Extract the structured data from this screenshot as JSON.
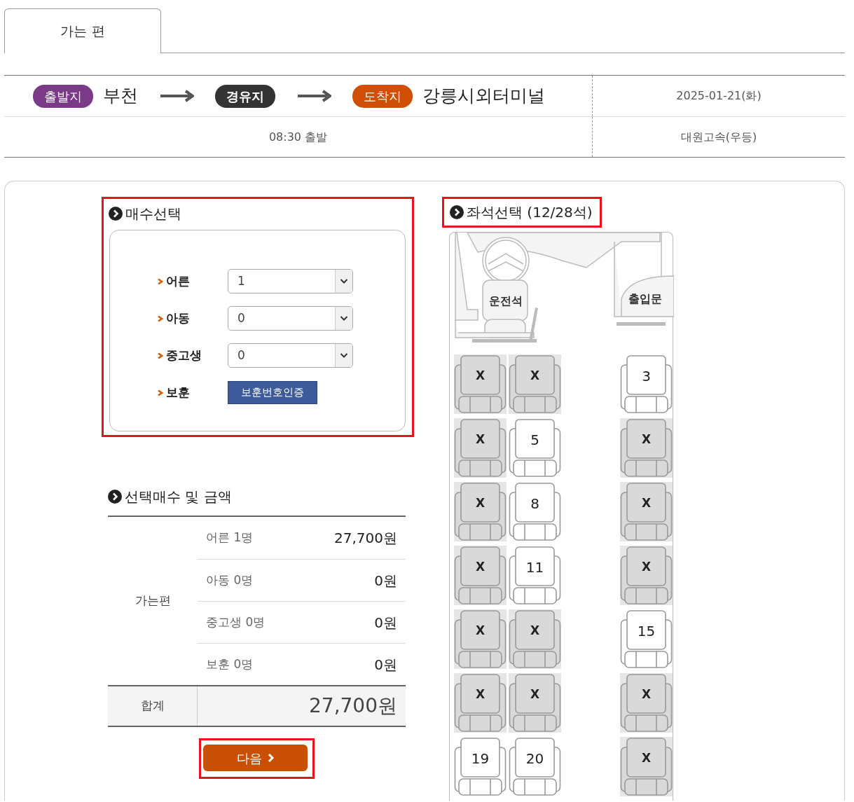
{
  "tabs": [
    {
      "label": "가는 편",
      "selected": true
    }
  ],
  "route": {
    "stops": [
      {
        "kind": "departure",
        "badge": "출발지",
        "name": "부천",
        "color": "#7b3a87"
      },
      {
        "kind": "via",
        "badge": "경유지",
        "color": "#333333"
      },
      {
        "kind": "arrival",
        "badge": "도착지",
        "name": "강릉시외터미널",
        "color": "#d04f05"
      }
    ],
    "date": "2025-01-21(화)",
    "time": "08:30 출발",
    "company": "대원고속(우등)"
  },
  "ticket_count": {
    "title": "매수선택",
    "highlighted": true,
    "rows": [
      {
        "kind": "select",
        "label": "어른",
        "value": "1"
      },
      {
        "kind": "select",
        "label": "아동",
        "value": "0"
      },
      {
        "kind": "select",
        "label": "중고생",
        "value": "0"
      },
      {
        "kind": "button",
        "label": "보훈",
        "button": "보훈번호인증"
      }
    ]
  },
  "summary": {
    "title": "선택매수 및 금액",
    "group": "가는편",
    "rows": [
      {
        "label": "어른 1명",
        "amount": "27,700원"
      },
      {
        "label": "아동 0명",
        "amount": "0원"
      },
      {
        "label": "중고생 0명",
        "amount": "0원"
      },
      {
        "label": "보훈 0명",
        "amount": "0원"
      }
    ],
    "total_label": "합계",
    "total": "27,700원"
  },
  "next_button": {
    "label": "다음",
    "highlighted": true
  },
  "seat_map": {
    "title": "좌석선택 (12/28석)",
    "highlighted": true,
    "driver_label": "운전석",
    "door_label": "출입문",
    "rows": [
      [
        {
          "label": "X",
          "taken": true
        },
        {
          "label": "X",
          "taken": true
        },
        {
          "label": "3",
          "taken": false
        }
      ],
      [
        {
          "label": "X",
          "taken": true
        },
        {
          "label": "5",
          "taken": false
        },
        {
          "label": "X",
          "taken": true
        }
      ],
      [
        {
          "label": "X",
          "taken": true
        },
        {
          "label": "8",
          "taken": false
        },
        {
          "label": "X",
          "taken": true
        }
      ],
      [
        {
          "label": "X",
          "taken": true
        },
        {
          "label": "11",
          "taken": false
        },
        {
          "label": "X",
          "taken": true
        }
      ],
      [
        {
          "label": "X",
          "taken": true
        },
        {
          "label": "X",
          "taken": true
        },
        {
          "label": "15",
          "taken": false
        }
      ],
      [
        {
          "label": "X",
          "taken": true
        },
        {
          "label": "X",
          "taken": true
        },
        {
          "label": "X",
          "taken": true
        }
      ],
      [
        {
          "label": "19",
          "taken": false
        },
        {
          "label": "20",
          "taken": false
        },
        {
          "label": "X",
          "taken": true
        }
      ]
    ]
  }
}
